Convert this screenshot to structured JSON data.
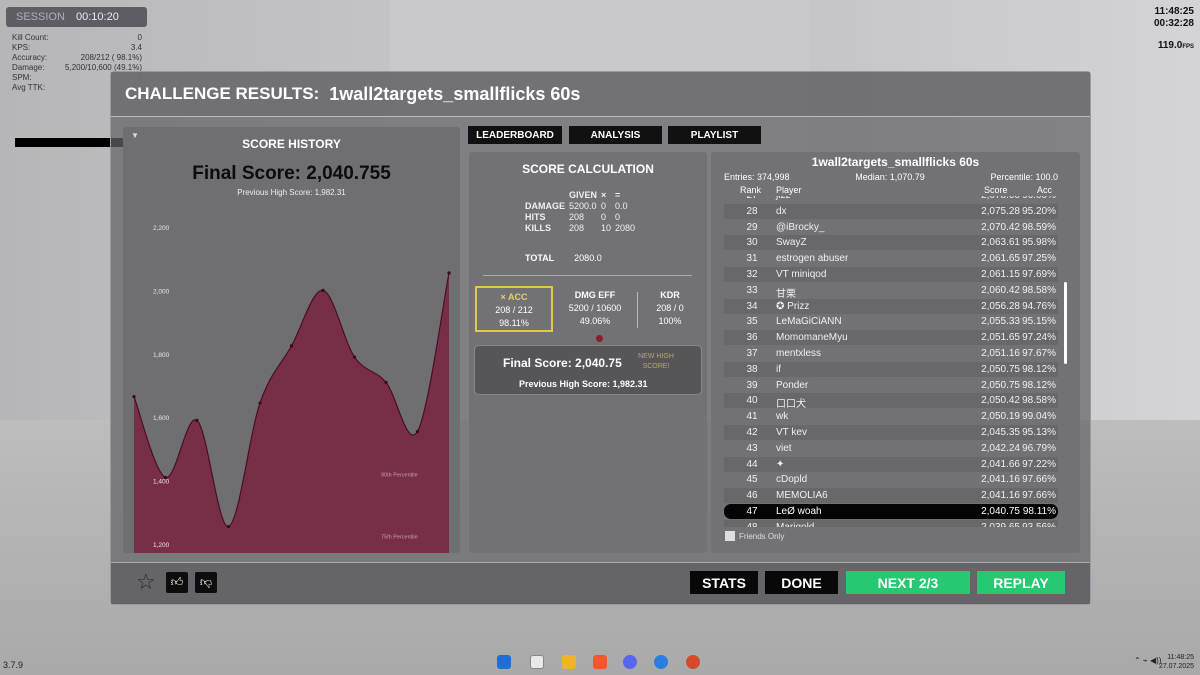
{
  "session": {
    "label": "SESSION",
    "time": "00:10:20"
  },
  "stats": [
    {
      "k": "Kill Count:",
      "v": "0"
    },
    {
      "k": "KPS:",
      "v": "3.4"
    },
    {
      "k": "Accuracy:",
      "v": "208/212 ( 98.1%)"
    },
    {
      "k": "Damage:",
      "v": "5,200/10,600 (49.1%)"
    },
    {
      "k": "SPM:",
      "v": "0"
    },
    {
      "k": "Avg TTK:",
      "v": "0.2"
    }
  ],
  "clock": {
    "time": "11:48:25",
    "elapsed": "00:32:28",
    "fps": "119.0",
    "fps_unit": "FPS"
  },
  "version": "3.7.9",
  "header": {
    "label": "CHALLENGE RESULTS:",
    "scenario": "1wall2targets_smallflicks 60s"
  },
  "history": {
    "title": "SCORE HISTORY",
    "final": "Final Score: 2,040.755",
    "previous": "Previous High Score: 1,982.31",
    "p90": "90th Percentile",
    "p75": "75th Percentile"
  },
  "chart_data": {
    "type": "area",
    "title": "SCORE HISTORY",
    "yticks": [
      "2,200",
      "2,000",
      "1,800",
      "1,600",
      "1,400",
      "1,200"
    ],
    "ylim": [
      1200,
      2200
    ],
    "values": [
      1665,
      1410,
      1590,
      1255,
      1645,
      1825,
      2000,
      1790,
      1710,
      1555,
      2055
    ],
    "color": "#7a2340"
  },
  "tabs": [
    "LEADERBOARD",
    "ANALYSIS",
    "PLAYLIST"
  ],
  "calc": {
    "title": "SCORE CALCULATION",
    "head": [
      "GIVEN",
      "×",
      "="
    ],
    "rows": [
      {
        "k": "DAMAGE",
        "a": "5200.0",
        "b": "0",
        "c": "0.0"
      },
      {
        "k": "HITS",
        "a": "208",
        "b": "0",
        "c": "0"
      },
      {
        "k": "KILLS",
        "a": "208",
        "b": "10",
        "c": "2080"
      }
    ],
    "total_label": "TOTAL",
    "total": "2080.0",
    "acc": {
      "h": "× ACC",
      "a": "208 / 212",
      "b": "98.11%"
    },
    "dmg": {
      "h": "DMG EFF",
      "a": "5200 / 10600",
      "b": "49.06%"
    },
    "kdr": {
      "h": "KDR",
      "a": "208 / 0",
      "b": "100%"
    },
    "final_label": "Final Score:",
    "final": "2,040.75",
    "new_high": "NEW HIGH SCORE!",
    "prev": "Previous High Score:  1,982.31"
  },
  "leaderboard": {
    "title": "1wall2targets_smallflicks 60s",
    "entries": "Entries: 374,998",
    "median": "Median: 1,070.79",
    "percentile": "Percentile: 100.0",
    "cols": [
      "Rank",
      "Player",
      "Score",
      "Acc"
    ],
    "rows": [
      [
        "27",
        "jizz",
        "2,078.00",
        "96.00%"
      ],
      [
        "28",
        "dx",
        "2,075.28",
        "95.20%"
      ],
      [
        "29",
        "@iBrocky_",
        "2,070.42",
        "98.59%"
      ],
      [
        "30",
        "SwayZ",
        "2,063.61",
        "95.98%"
      ],
      [
        "31",
        "estrogen abuser",
        "2,061.65",
        "97.25%"
      ],
      [
        "32",
        "VT miniqod",
        "2,061.15",
        "97.69%"
      ],
      [
        "33",
        "甘栗",
        "2,060.42",
        "98.58%"
      ],
      [
        "34",
        "✪ Prizz",
        "2,056.28",
        "94.76%"
      ],
      [
        "35",
        "LeMaGiCiANN",
        "2,055.33",
        "95.15%"
      ],
      [
        "36",
        "MomomaneMyu",
        "2,051.65",
        "97.24%"
      ],
      [
        "37",
        "mentxless",
        "2,051.16",
        "97.67%"
      ],
      [
        "38",
        "if",
        "2,050.75",
        "98.12%"
      ],
      [
        "39",
        "Ponder",
        "2,050.75",
        "98.12%"
      ],
      [
        "40",
        "口口犬",
        "2,050.42",
        "98.58%"
      ],
      [
        "41",
        "wk",
        "2,050.19",
        "99.04%"
      ],
      [
        "42",
        "VT kev",
        "2,045.35",
        "95.13%"
      ],
      [
        "43",
        "viet",
        "2,042.24",
        "96.79%"
      ],
      [
        "44",
        "✦",
        "2,041.66",
        "97.22%"
      ],
      [
        "45",
        "cDopld",
        "2,041.16",
        "97.66%"
      ],
      [
        "46",
        "MEMOLIA6",
        "2,041.16",
        "97.66%"
      ],
      [
        "47",
        "LeØ woah",
        "2,040.75",
        "98.11%"
      ],
      [
        "48",
        "Marigold",
        "2,039.65",
        "93.56%"
      ]
    ],
    "friends": "Friends Only"
  },
  "bottom": {
    "stats": "STATS",
    "done": "DONE",
    "next": "NEXT 2/3",
    "replay": "REPLAY"
  },
  "tray": {
    "time": "11:48:25",
    "date": "27.07.2025"
  }
}
